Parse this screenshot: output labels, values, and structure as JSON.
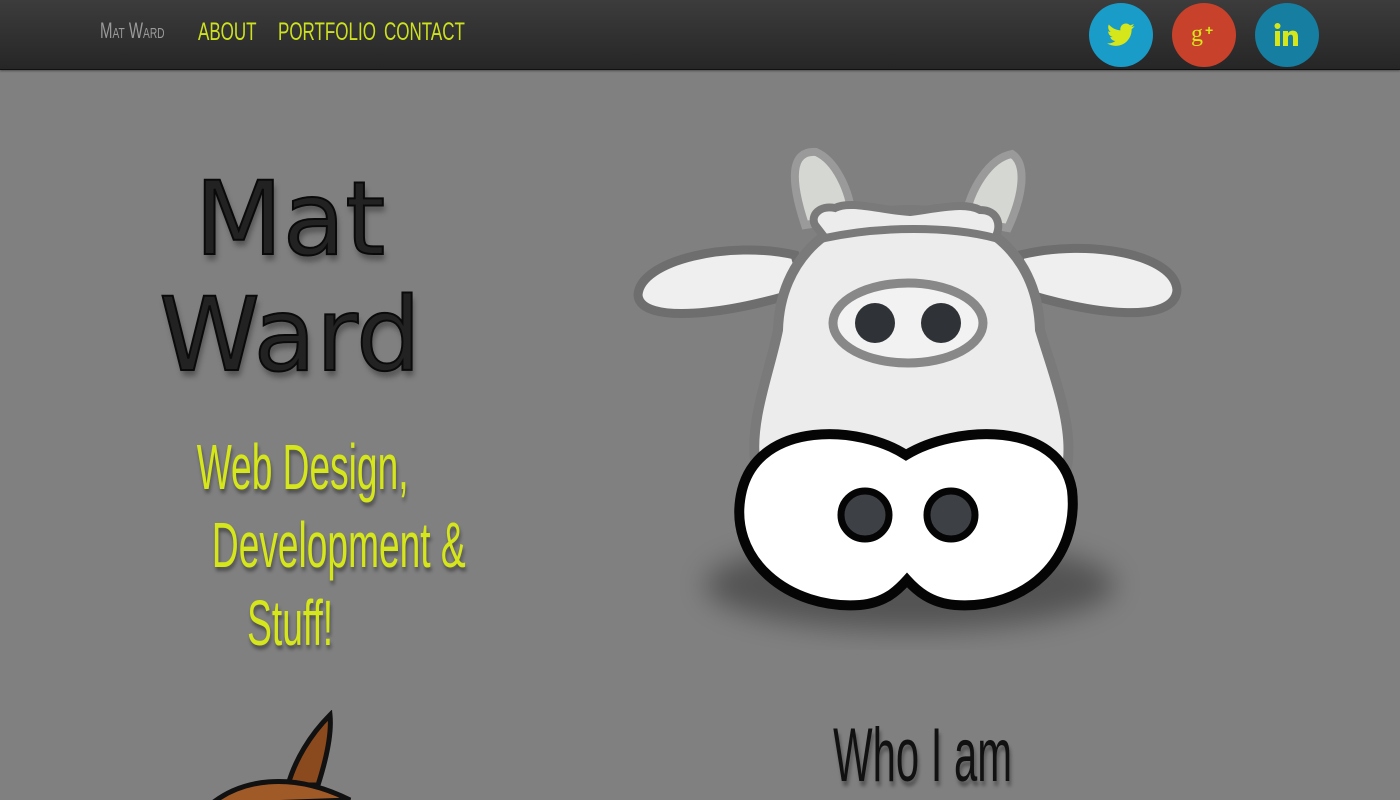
{
  "nav": {
    "brand": "Mat Ward",
    "links": [
      "ABOUT",
      "PORTFOLIO",
      "CONTACT"
    ]
  },
  "social": [
    {
      "name": "twitter",
      "icon": "twitter-icon",
      "color": "#1a9cc9"
    },
    {
      "name": "google-plus",
      "icon": "google-plus-icon",
      "color": "#c8412b"
    },
    {
      "name": "linkedin",
      "icon": "linkedin-icon",
      "color": "#157ea1"
    }
  ],
  "hero": {
    "name_line1": "Mat",
    "name_line2": "Ward",
    "tagline_line1": "Web Design,",
    "tagline_line2": "Development &",
    "tagline_line3": "Stuff!"
  },
  "about": {
    "title": "Who I am"
  },
  "colors": {
    "accent": "#cde11f",
    "background": "#808080",
    "navbar": "#2f2f2f"
  }
}
